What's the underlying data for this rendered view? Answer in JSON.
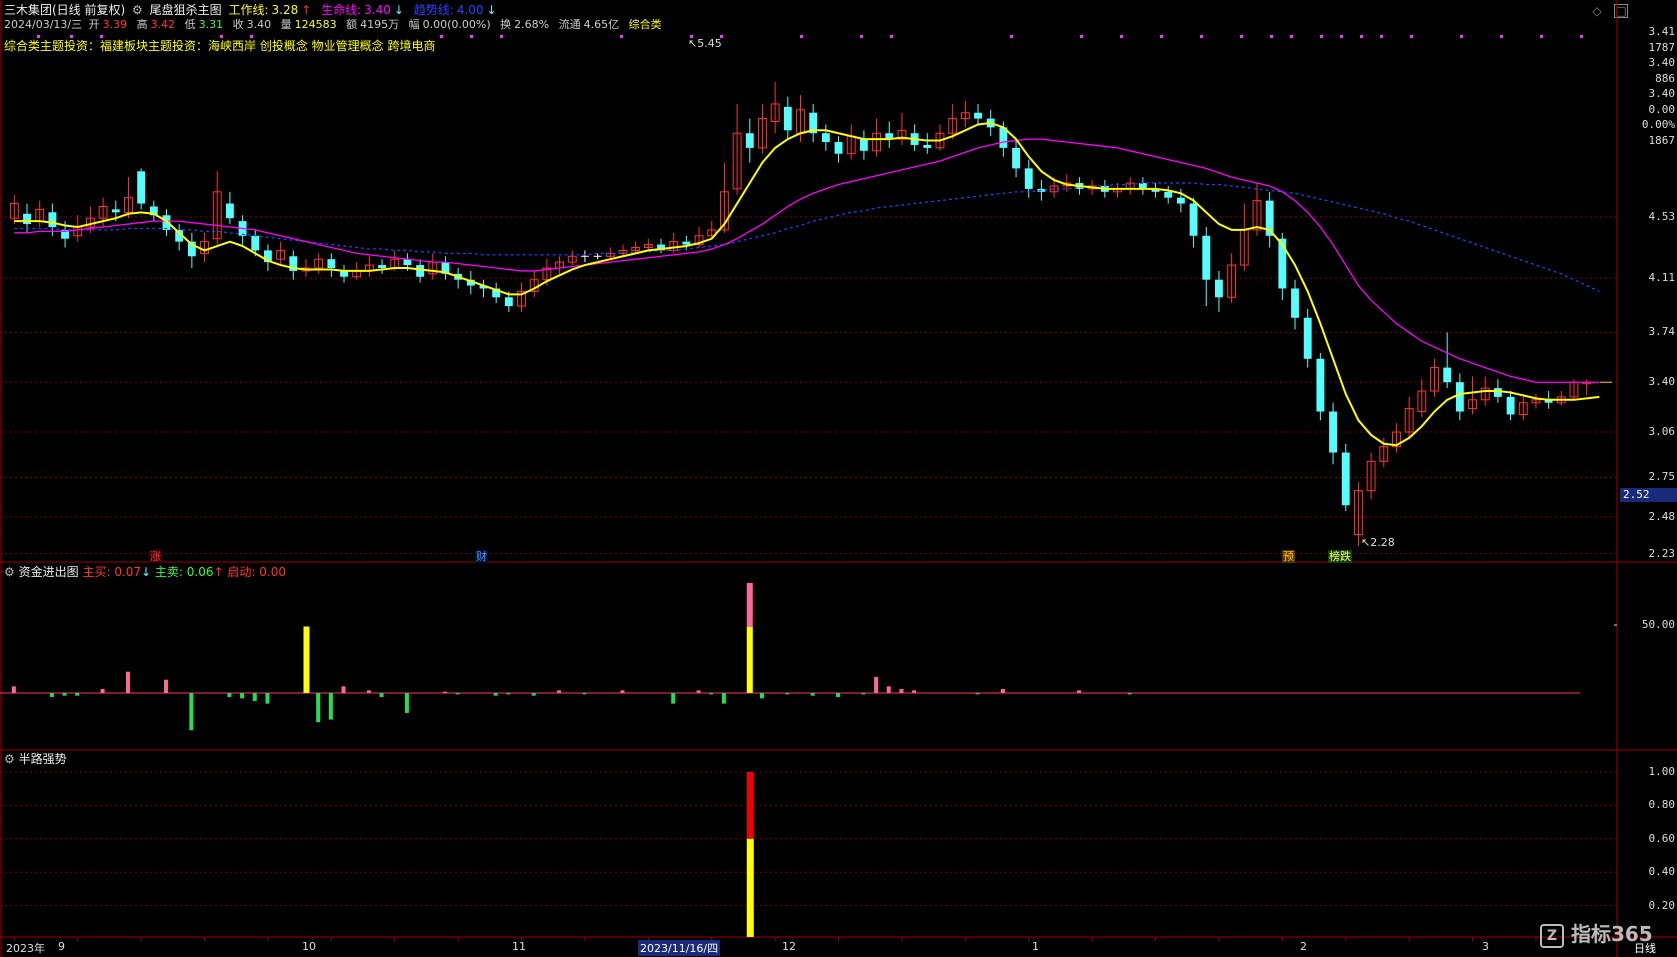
{
  "window": {
    "stock": "三木集团(日线 前复权)",
    "indicator": "尾盘狙杀主图",
    "lines": [
      {
        "label": "工作线:",
        "value": "3.28",
        "arrow": "↑",
        "color": "#ffff00"
      },
      {
        "label": "生命线:",
        "value": "3.40",
        "arrow": "↓",
        "color": "#ff00ff"
      },
      {
        "label": "趋势线:",
        "value": "4.00",
        "arrow": "↓",
        "color": "#2244ff"
      }
    ]
  },
  "quote": {
    "date": "2024/03/13/三",
    "open_l": "开",
    "open": "3.39",
    "high_l": "高",
    "high": "3.42",
    "low_l": "低",
    "low": "3.31",
    "close_l": "收",
    "close": "3.40",
    "vol_l": "量",
    "vol": "124583",
    "amt_l": "额",
    "amt": "4195万",
    "chg_l": "幅",
    "chg": "0.00(0.00%)",
    "turn_l": "换",
    "turn": "2.68%",
    "float_l": "流通",
    "float": "4.65亿",
    "tag": "综合类"
  },
  "concepts": "综合类主题投资：福建板块主题投资：海峡西岸 创投概念 物业管理概念 跨境电商",
  "price_axis": {
    "top": [
      "3.41",
      "1787",
      "3.40",
      "886",
      "3.40",
      "0.00",
      "0.00%",
      "1867"
    ],
    "ticks": [
      4.53,
      4.11,
      3.74,
      3.4,
      3.06,
      2.75,
      2.48,
      2.23
    ],
    "tick_labels": [
      "4.53",
      "4.11",
      "3.74",
      "3.40",
      "3.06",
      "2.75",
      "2.48",
      "2.23"
    ],
    "current": "2.52",
    "high_mark": "5.45",
    "low_mark": "2.28"
  },
  "events": [
    {
      "text": "涨",
      "color": "#ff3333",
      "bg": "#330000"
    },
    {
      "text": "财",
      "color": "#5599ff",
      "bg": "#001133"
    },
    {
      "text": "预",
      "color": "#ffcc00",
      "bg": "#553300"
    },
    {
      "text": "榜跌",
      "color": "#ffff66",
      "bg": "#114411"
    }
  ],
  "panel2": {
    "title": "资金进出图",
    "buy_l": "主买:",
    "buy": "0.07",
    "buy_arrow": "↓",
    "sell_l": "主卖:",
    "sell": "0.06",
    "sell_arrow": "↑",
    "start_l": "启动:",
    "start": "0.00",
    "axis": "50.00"
  },
  "panel3": {
    "title": "半路强势",
    "axis": [
      "1.00",
      "0.80",
      "0.60",
      "0.40",
      "0.20"
    ]
  },
  "xaxis": {
    "labels": [
      "2023年",
      "9",
      "10",
      "11",
      "2023/11/16/四",
      "12",
      "1",
      "2",
      "3"
    ],
    "mode": "日线"
  },
  "watermark": "指标365",
  "colors": {
    "up": "#ff3333",
    "down": "#54ffff",
    "grid": "#7a0000",
    "work": "#ffff00",
    "life": "#ff00ff",
    "trend": "#2244ff"
  },
  "chart_data": {
    "type": "candlestick",
    "ylim": [
      2.2,
      5.6
    ],
    "candles": [
      [
        4.52,
        4.62,
        4.68,
        4.48
      ],
      [
        4.55,
        4.48,
        4.62,
        4.42
      ],
      [
        4.5,
        4.58,
        4.64,
        4.46
      ],
      [
        4.56,
        4.46,
        4.62,
        4.4
      ],
      [
        4.44,
        4.38,
        4.5,
        4.32
      ],
      [
        4.4,
        4.46,
        4.54,
        4.36
      ],
      [
        4.46,
        4.52,
        4.6,
        4.42
      ],
      [
        4.52,
        4.6,
        4.66,
        4.46
      ],
      [
        4.58,
        4.56,
        4.64,
        4.5
      ],
      [
        4.56,
        4.66,
        4.8,
        4.52
      ],
      [
        4.84,
        4.62,
        4.86,
        4.58
      ],
      [
        4.6,
        4.54,
        4.64,
        4.5
      ],
      [
        4.54,
        4.44,
        4.58,
        4.4
      ],
      [
        4.44,
        4.36,
        4.48,
        4.3
      ],
      [
        4.36,
        4.26,
        4.42,
        4.18
      ],
      [
        4.28,
        4.36,
        4.42,
        4.22
      ],
      [
        4.38,
        4.7,
        4.84,
        4.34
      ],
      [
        4.62,
        4.52,
        4.7,
        4.48
      ],
      [
        4.5,
        4.4,
        4.54,
        4.34
      ],
      [
        4.4,
        4.3,
        4.44,
        4.26
      ],
      [
        4.3,
        4.22,
        4.34,
        4.16
      ],
      [
        4.24,
        4.3,
        4.36,
        4.2
      ],
      [
        4.26,
        4.16,
        4.3,
        4.1
      ],
      [
        4.16,
        4.18,
        4.24,
        4.12
      ],
      [
        4.18,
        4.24,
        4.28,
        4.14
      ],
      [
        4.24,
        4.18,
        4.28,
        4.12
      ],
      [
        4.16,
        4.12,
        4.2,
        4.08
      ],
      [
        4.12,
        4.16,
        4.22,
        4.1
      ],
      [
        4.16,
        4.2,
        4.26,
        4.12
      ],
      [
        4.2,
        4.18,
        4.24,
        4.14
      ],
      [
        4.18,
        4.24,
        4.3,
        4.16
      ],
      [
        4.24,
        4.2,
        4.28,
        4.16
      ],
      [
        4.2,
        4.12,
        4.24,
        4.08
      ],
      [
        4.14,
        4.22,
        4.28,
        4.1
      ],
      [
        4.22,
        4.14,
        4.26,
        4.1
      ],
      [
        4.14,
        4.1,
        4.18,
        4.04
      ],
      [
        4.1,
        4.06,
        4.16,
        4.0
      ],
      [
        4.06,
        4.04,
        4.1,
        3.98
      ],
      [
        4.04,
        3.98,
        4.08,
        3.94
      ],
      [
        3.98,
        3.92,
        4.02,
        3.88
      ],
      [
        3.92,
        4.02,
        4.08,
        3.88
      ],
      [
        4.02,
        4.1,
        4.16,
        3.98
      ],
      [
        4.1,
        4.18,
        4.24,
        4.06
      ],
      [
        4.18,
        4.22,
        4.26,
        4.14
      ],
      [
        4.22,
        4.26,
        4.3,
        4.2
      ],
      [
        4.26,
        4.26,
        4.3,
        4.22
      ],
      [
        4.26,
        4.26,
        4.28,
        4.24
      ],
      [
        4.26,
        4.28,
        4.32,
        4.24
      ],
      [
        4.28,
        4.3,
        4.34,
        4.26
      ],
      [
        4.3,
        4.32,
        4.36,
        4.28
      ],
      [
        4.32,
        4.34,
        4.38,
        4.3
      ],
      [
        4.34,
        4.3,
        4.38,
        4.28
      ],
      [
        4.3,
        4.36,
        4.42,
        4.28
      ],
      [
        4.36,
        4.34,
        4.4,
        4.3
      ],
      [
        4.34,
        4.4,
        4.46,
        4.32
      ],
      [
        4.4,
        4.44,
        4.5,
        4.38
      ],
      [
        4.44,
        4.7,
        4.9,
        4.42
      ],
      [
        4.72,
        5.1,
        5.3,
        4.68
      ],
      [
        5.1,
        5.0,
        5.2,
        4.9
      ],
      [
        5.0,
        5.2,
        5.3,
        4.96
      ],
      [
        5.18,
        5.3,
        5.45,
        5.1
      ],
      [
        5.28,
        5.12,
        5.35,
        5.06
      ],
      [
        5.1,
        5.26,
        5.36,
        5.04
      ],
      [
        5.24,
        5.1,
        5.3,
        5.04
      ],
      [
        5.1,
        5.04,
        5.16,
        4.98
      ],
      [
        5.04,
        4.96,
        5.08,
        4.9
      ],
      [
        4.96,
        5.08,
        5.16,
        4.92
      ],
      [
        5.06,
        4.98,
        5.12,
        4.92
      ],
      [
        4.98,
        5.1,
        5.2,
        4.94
      ],
      [
        5.1,
        5.06,
        5.18,
        5.0
      ],
      [
        5.06,
        5.12,
        5.24,
        5.02
      ],
      [
        5.1,
        5.02,
        5.16,
        4.98
      ],
      [
        5.02,
        5.0,
        5.1,
        4.96
      ],
      [
        5.0,
        5.1,
        5.16,
        4.98
      ],
      [
        5.1,
        5.2,
        5.3,
        5.06
      ],
      [
        5.2,
        5.24,
        5.32,
        5.14
      ],
      [
        5.24,
        5.2,
        5.3,
        5.16
      ],
      [
        5.2,
        5.14,
        5.26,
        5.08
      ],
      [
        5.14,
        5.0,
        5.18,
        4.94
      ],
      [
        5.0,
        4.86,
        5.06,
        4.8
      ],
      [
        4.86,
        4.72,
        4.92,
        4.66
      ],
      [
        4.72,
        4.7,
        4.78,
        4.64
      ],
      [
        4.7,
        4.74,
        4.8,
        4.66
      ],
      [
        4.74,
        4.76,
        4.82,
        4.7
      ],
      [
        4.76,
        4.72,
        4.8,
        4.68
      ],
      [
        4.72,
        4.74,
        4.78,
        4.68
      ],
      [
        4.74,
        4.7,
        4.78,
        4.66
      ],
      [
        4.7,
        4.72,
        4.76,
        4.66
      ],
      [
        4.72,
        4.76,
        4.8,
        4.68
      ],
      [
        4.76,
        4.72,
        4.8,
        4.68
      ],
      [
        4.72,
        4.7,
        4.76,
        4.66
      ],
      [
        4.7,
        4.66,
        4.74,
        4.62
      ],
      [
        4.66,
        4.62,
        4.72,
        4.56
      ],
      [
        4.62,
        4.4,
        4.66,
        4.32
      ],
      [
        4.4,
        4.1,
        4.46,
        3.92
      ],
      [
        4.1,
        3.98,
        4.16,
        3.88
      ],
      [
        3.98,
        4.2,
        4.28,
        3.94
      ],
      [
        4.2,
        4.44,
        4.62,
        4.16
      ],
      [
        4.44,
        4.64,
        4.76,
        4.4
      ],
      [
        4.64,
        4.4,
        4.7,
        4.32
      ],
      [
        4.38,
        4.04,
        4.42,
        3.96
      ],
      [
        4.04,
        3.84,
        4.1,
        3.76
      ],
      [
        3.84,
        3.56,
        3.9,
        3.5
      ],
      [
        3.56,
        3.2,
        3.6,
        3.14
      ],
      [
        3.2,
        2.92,
        3.26,
        2.84
      ],
      [
        2.92,
        2.56,
        2.98,
        2.52
      ],
      [
        2.36,
        2.66,
        2.72,
        2.28
      ],
      [
        2.66,
        2.86,
        2.92,
        2.6
      ],
      [
        2.86,
        2.96,
        3.02,
        2.82
      ],
      [
        2.96,
        3.06,
        3.12,
        2.92
      ],
      [
        3.06,
        3.22,
        3.3,
        3.02
      ],
      [
        3.2,
        3.34,
        3.42,
        3.16
      ],
      [
        3.34,
        3.5,
        3.56,
        3.3
      ],
      [
        3.5,
        3.4,
        3.74,
        3.36
      ],
      [
        3.4,
        3.2,
        3.46,
        3.14
      ],
      [
        3.22,
        3.28,
        3.44,
        3.18
      ],
      [
        3.28,
        3.36,
        3.44,
        3.24
      ],
      [
        3.36,
        3.3,
        3.42,
        3.26
      ],
      [
        3.3,
        3.18,
        3.34,
        3.14
      ],
      [
        3.18,
        3.26,
        3.32,
        3.14
      ],
      [
        3.26,
        3.28,
        3.32,
        3.22
      ],
      [
        3.28,
        3.26,
        3.34,
        3.22
      ],
      [
        3.26,
        3.3,
        3.34,
        3.24
      ],
      [
        3.3,
        3.4,
        3.42,
        3.28
      ],
      [
        3.39,
        3.4,
        3.42,
        3.31
      ]
    ],
    "work_line": [
      4.5,
      4.5,
      4.5,
      4.49,
      4.47,
      4.46,
      4.48,
      4.5,
      4.52,
      4.55,
      4.56,
      4.55,
      4.5,
      4.42,
      4.34,
      4.3,
      4.33,
      4.36,
      4.33,
      4.28,
      4.23,
      4.2,
      4.18,
      4.17,
      4.17,
      4.17,
      4.16,
      4.16,
      4.16,
      4.17,
      4.18,
      4.18,
      4.17,
      4.16,
      4.15,
      4.12,
      4.09,
      4.06,
      4.03,
      4.0,
      4.0,
      4.04,
      4.09,
      4.13,
      4.17,
      4.2,
      4.22,
      4.24,
      4.26,
      4.28,
      4.3,
      4.31,
      4.32,
      4.33,
      4.35,
      4.38,
      4.48,
      4.62,
      4.76,
      4.9,
      5.0,
      5.06,
      5.1,
      5.12,
      5.12,
      5.1,
      5.08,
      5.06,
      5.06,
      5.06,
      5.07,
      5.06,
      5.05,
      5.05,
      5.08,
      5.12,
      5.16,
      5.17,
      5.14,
      5.06,
      4.94,
      4.84,
      4.78,
      4.75,
      4.74,
      4.73,
      4.72,
      4.72,
      4.72,
      4.72,
      4.72,
      4.71,
      4.69,
      4.64,
      4.56,
      4.48,
      4.44,
      4.44,
      4.46,
      4.44,
      4.34,
      4.2,
      4.02,
      3.8,
      3.56,
      3.32,
      3.14,
      3.04,
      2.98,
      2.97,
      3.02,
      3.1,
      3.2,
      3.28,
      3.32,
      3.33,
      3.34,
      3.34,
      3.33,
      3.31,
      3.29,
      3.28,
      3.28,
      3.28,
      3.29,
      3.3
    ],
    "life_line": [
      4.42,
      4.42,
      4.43,
      4.43,
      4.43,
      4.44,
      4.45,
      4.46,
      4.47,
      4.48,
      4.49,
      4.5,
      4.5,
      4.5,
      4.49,
      4.48,
      4.47,
      4.46,
      4.45,
      4.44,
      4.42,
      4.4,
      4.38,
      4.36,
      4.34,
      4.32,
      4.3,
      4.28,
      4.27,
      4.26,
      4.25,
      4.24,
      4.23,
      4.22,
      4.22,
      4.21,
      4.2,
      4.19,
      4.18,
      4.17,
      4.16,
      4.16,
      4.17,
      4.18,
      4.19,
      4.2,
      4.21,
      4.22,
      4.23,
      4.24,
      4.25,
      4.26,
      4.27,
      4.28,
      4.29,
      4.31,
      4.34,
      4.38,
      4.43,
      4.48,
      4.54,
      4.6,
      4.65,
      4.69,
      4.72,
      4.75,
      4.77,
      4.79,
      4.81,
      4.83,
      4.85,
      4.87,
      4.89,
      4.91,
      4.94,
      4.97,
      5.0,
      5.02,
      5.04,
      5.05,
      5.06,
      5.06,
      5.05,
      5.04,
      5.03,
      5.02,
      5.01,
      5.0,
      4.98,
      4.96,
      4.94,
      4.92,
      4.9,
      4.88,
      4.86,
      4.83,
      4.8,
      4.78,
      4.76,
      4.74,
      4.7,
      4.64,
      4.56,
      4.46,
      4.34,
      4.2,
      4.06,
      3.96,
      3.88,
      3.8,
      3.74,
      3.68,
      3.64,
      3.6,
      3.56,
      3.53,
      3.5,
      3.47,
      3.44,
      3.42,
      3.4,
      3.4,
      3.4,
      3.4,
      3.4,
      3.4
    ],
    "trend_line": [
      4.45,
      4.45,
      4.45,
      4.45,
      4.44,
      4.44,
      4.44,
      4.44,
      4.44,
      4.45,
      4.45,
      4.45,
      4.45,
      4.44,
      4.44,
      4.43,
      4.43,
      4.42,
      4.41,
      4.4,
      4.39,
      4.38,
      4.37,
      4.36,
      4.35,
      4.34,
      4.33,
      4.32,
      4.31,
      4.31,
      4.3,
      4.3,
      4.29,
      4.29,
      4.28,
      4.28,
      4.28,
      4.27,
      4.27,
      4.27,
      4.27,
      4.27,
      4.27,
      4.27,
      4.27,
      4.27,
      4.28,
      4.28,
      4.28,
      4.29,
      4.29,
      4.3,
      4.3,
      4.31,
      4.32,
      4.33,
      4.34,
      4.36,
      4.38,
      4.4,
      4.42,
      4.45,
      4.47,
      4.5,
      4.52,
      4.54,
      4.56,
      4.57,
      4.59,
      4.6,
      4.61,
      4.62,
      4.63,
      4.64,
      4.65,
      4.66,
      4.67,
      4.68,
      4.69,
      4.7,
      4.7,
      4.71,
      4.72,
      4.72,
      4.73,
      4.74,
      4.74,
      4.75,
      4.75,
      4.76,
      4.76,
      4.76,
      4.76,
      4.76,
      4.75,
      4.75,
      4.74,
      4.73,
      4.72,
      4.71,
      4.7,
      4.69,
      4.67,
      4.65,
      4.63,
      4.61,
      4.59,
      4.57,
      4.55,
      4.52,
      4.5,
      4.47,
      4.44,
      4.41,
      4.38,
      4.35,
      4.32,
      4.29,
      4.26,
      4.23,
      4.2,
      4.17,
      4.14,
      4.1,
      4.06,
      4.02
    ],
    "money_flow": [
      5,
      0,
      0,
      -3,
      -2,
      -2,
      0,
      3,
      0,
      16,
      0,
      0,
      10,
      0,
      -28,
      0,
      0,
      -3,
      -4,
      -6,
      -8,
      0,
      0,
      50,
      -22,
      -20,
      5,
      0,
      2,
      -3,
      0,
      -15,
      0,
      0,
      1,
      -1,
      0,
      0,
      -2,
      -1,
      0,
      -2,
      0,
      2,
      0,
      -1,
      0,
      0,
      2,
      0,
      0,
      0,
      -8,
      0,
      2,
      -1,
      -8,
      0,
      0,
      -4,
      0,
      -1,
      0,
      -2,
      0,
      -3,
      0,
      -1,
      12,
      5,
      3,
      2,
      0,
      0,
      0,
      0,
      -1,
      0,
      3,
      0,
      0,
      0,
      0,
      0,
      2,
      0,
      0,
      0,
      -1,
      0,
      0,
      0,
      0,
      0,
      0,
      0,
      0,
      0,
      0,
      0,
      0,
      0,
      0,
      0,
      0,
      0,
      0,
      0,
      0,
      0,
      0,
      0,
      0,
      0,
      0,
      0,
      0,
      0,
      0,
      0,
      0,
      0,
      0,
      0,
      0,
      0
    ],
    "strength_bar_index": 58,
    "strength_value": 1.0
  }
}
